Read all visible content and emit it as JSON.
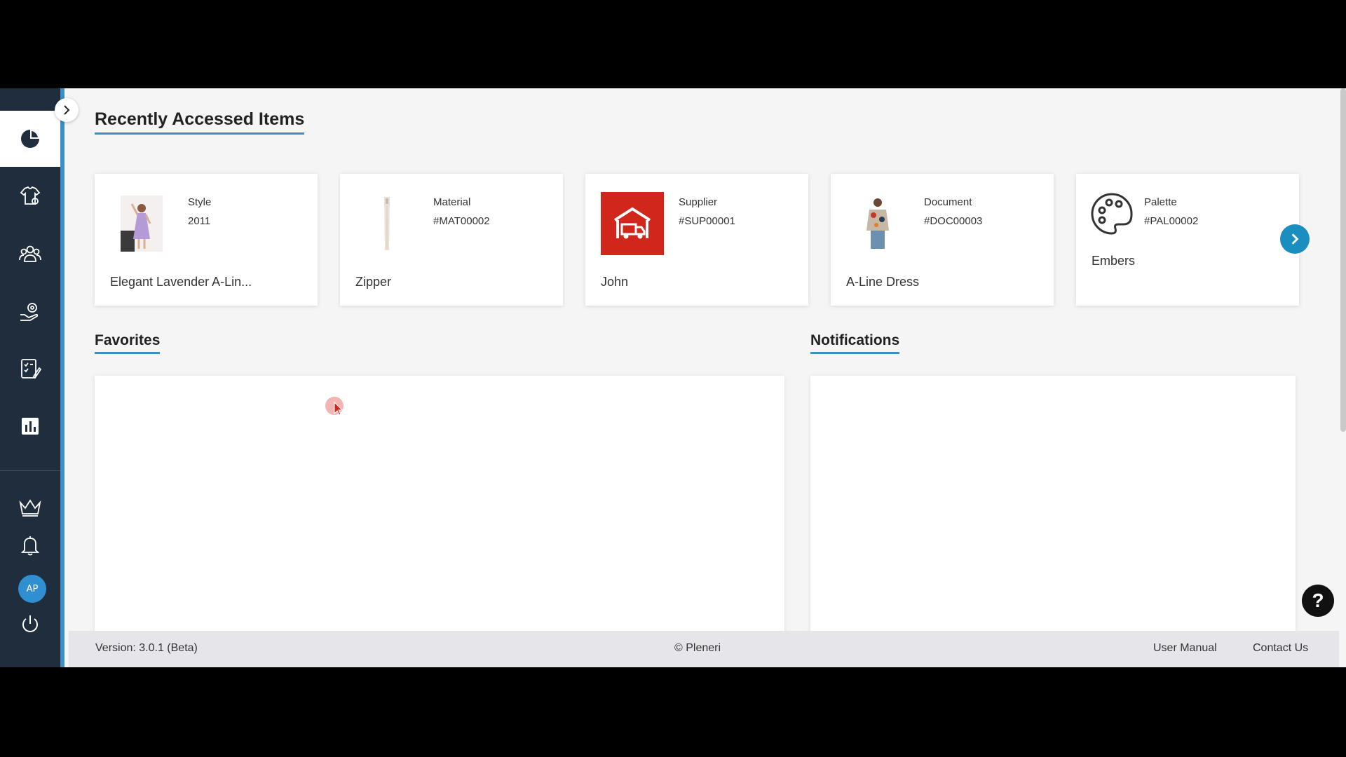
{
  "sidebar": {
    "items": [
      {
        "name": "dashboard",
        "icon": "pie-chart-icon",
        "active": true
      },
      {
        "name": "styles",
        "icon": "shirt-tag-icon"
      },
      {
        "name": "partners",
        "icon": "users-group-icon"
      },
      {
        "name": "workflow",
        "icon": "hand-gear-icon"
      },
      {
        "name": "tasks",
        "icon": "checklist-edit-icon"
      },
      {
        "name": "reports",
        "icon": "bar-chart-icon"
      }
    ],
    "bottom": {
      "premium_icon": "crown-icon",
      "notifications_icon": "bell-icon",
      "avatar_initials": "AP",
      "logout_icon": "power-icon"
    },
    "accent": "#3a8fc7"
  },
  "recent": {
    "title": "Recently Accessed Items",
    "items": [
      {
        "type": "Style",
        "code": "2011",
        "name": "Elegant Lavender A-Lin..."
      },
      {
        "type": "Material",
        "code": "#MAT00002",
        "name": "Zipper"
      },
      {
        "type": "Supplier",
        "code": "#SUP00001",
        "name": "John"
      },
      {
        "type": "Document",
        "code": "#DOC00003",
        "name": "A-Line Dress"
      },
      {
        "type": "Palette",
        "code": "#PAL00002",
        "name": "Embers"
      }
    ]
  },
  "favorites": {
    "title": "Favorites"
  },
  "notifications": {
    "title": "Notifications"
  },
  "footer": {
    "version": "Version: 3.0.1 (Beta)",
    "copyright": "© Pleneri",
    "user_manual": "User Manual",
    "contact_us": "Contact Us"
  },
  "help": {
    "label": "?"
  },
  "colors": {
    "brand_blue": "#3a8fc7",
    "sidebar_bg": "#1f2d3d",
    "supplier_red": "#d0261b",
    "next_button": "#1a8fbf"
  }
}
